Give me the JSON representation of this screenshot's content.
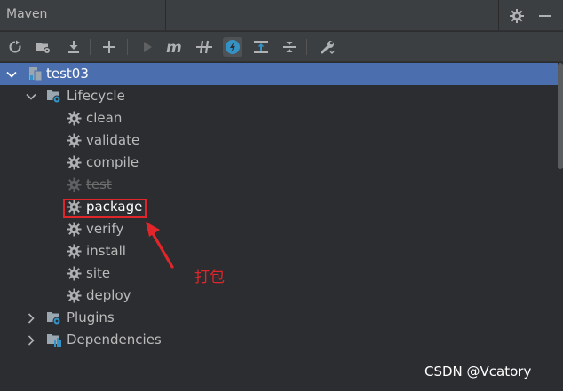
{
  "window": {
    "title": "Maven"
  },
  "titlebar": {
    "settings_icon": "gear-icon",
    "minimize_icon": "minimize-icon"
  },
  "toolbar": {
    "buttons": [
      {
        "icon": "reload-icon"
      },
      {
        "icon": "generate-sources-icon"
      },
      {
        "icon": "download-icon"
      },
      {
        "icon": "add-icon"
      },
      {
        "icon": "run-icon"
      },
      {
        "icon": "execute-goal-icon"
      },
      {
        "icon": "toggle-offline-icon"
      },
      {
        "icon": "skip-tests-icon",
        "active": true
      },
      {
        "icon": "show-dependencies-icon"
      },
      {
        "icon": "collapse-all-icon"
      },
      {
        "icon": "settings-wrench-icon"
      }
    ]
  },
  "tree": {
    "project": {
      "label": "test03",
      "selected": true
    },
    "lifecycle": {
      "label": "Lifecycle",
      "items": [
        {
          "label": "clean",
          "disabled": false
        },
        {
          "label": "validate",
          "disabled": false
        },
        {
          "label": "compile",
          "disabled": false
        },
        {
          "label": "test",
          "disabled": true
        },
        {
          "label": "package",
          "disabled": false,
          "highlighted": true
        },
        {
          "label": "verify",
          "disabled": false
        },
        {
          "label": "install",
          "disabled": false
        },
        {
          "label": "site",
          "disabled": false
        },
        {
          "label": "deploy",
          "disabled": false
        }
      ]
    },
    "plugins": {
      "label": "Plugins"
    },
    "dependencies": {
      "label": "Dependencies"
    }
  },
  "annotation": {
    "text": "打包",
    "color": "#e0262a"
  },
  "watermark": {
    "text": "CSDN @Vcatory"
  },
  "colors": {
    "selection": "#4b6eaf",
    "accent": "#3592c4",
    "background": "#2b2d30"
  }
}
